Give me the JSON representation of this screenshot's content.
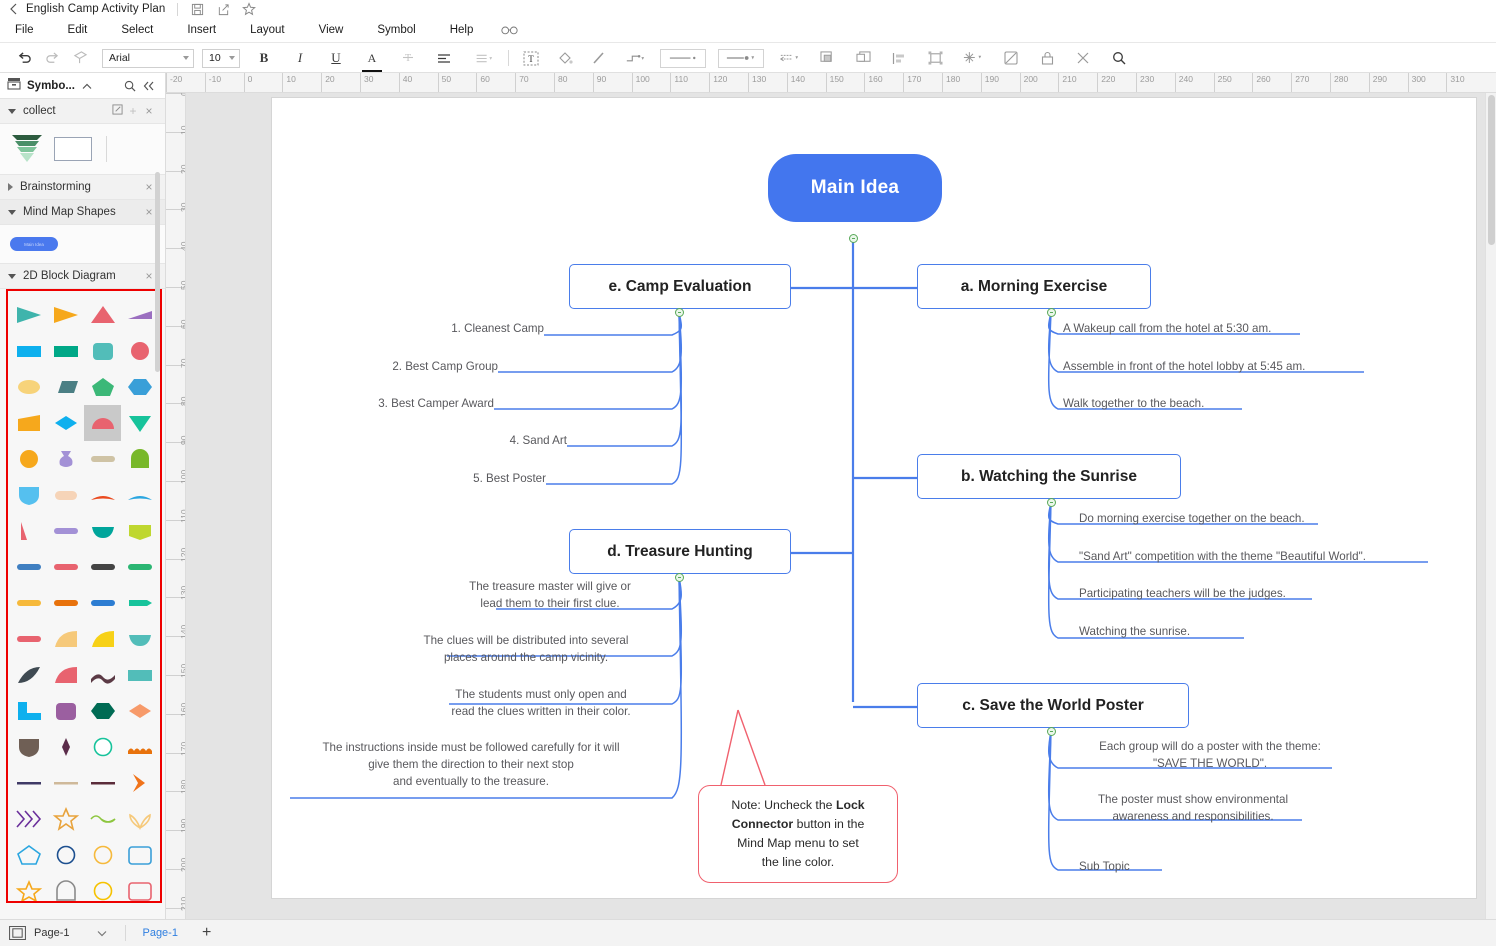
{
  "titlebar": {
    "back_icon": "chevron-left-icon",
    "document_title": "English Camp Activity Plan",
    "icons": [
      "save-icon",
      "share-icon",
      "star-icon"
    ]
  },
  "menubar": {
    "items": [
      "File",
      "Edit",
      "Select",
      "Insert",
      "Layout",
      "View",
      "Symbol",
      "Help"
    ],
    "trailing_icon": "glasses-icon"
  },
  "toolbar": {
    "font_family": "Arial",
    "font_size": "10",
    "groups": [
      {
        "name": "history",
        "icons": [
          "undo-icon",
          "redo-icon",
          "format-painter-icon"
        ]
      },
      {
        "name": "text-format",
        "icons": [
          "bold-icon",
          "italic-icon",
          "underline-icon",
          "font-color-icon",
          "strikethrough-icon",
          "align-icon",
          "line-spacing-icon"
        ]
      },
      {
        "name": "shape-tools",
        "icons": [
          "text-box-icon",
          "fill-color-icon",
          "line-color-icon",
          "connector-icon"
        ]
      },
      {
        "name": "line-style",
        "icons": [
          "line-weight-dropdown",
          "arrow-style-dropdown",
          "arrow-direction-icon"
        ]
      },
      {
        "name": "arrange",
        "icons": [
          "bring-forward-icon",
          "send-backward-icon",
          "align-left-icon",
          "group-icon",
          "effects-icon",
          "no-fill-icon",
          "lock-icon",
          "tools-icon",
          "search-icon"
        ]
      }
    ]
  },
  "sidebar": {
    "header_title": "Symbo...",
    "header_icons": [
      "library-icon",
      "collapse-chevron-icon",
      "search-icon",
      "double-chevron-left-icon"
    ],
    "sections": [
      {
        "label": "collect",
        "expanded": true,
        "icons": [
          "edit-icon",
          "plus-icon",
          "close-icon"
        ]
      },
      {
        "label": "Brainstorming",
        "expanded": false,
        "icons": [
          "close-icon"
        ]
      },
      {
        "label": "Mind Map Shapes",
        "expanded": true,
        "icons": [
          "close-icon"
        ]
      },
      {
        "label": "2D Block Diagram",
        "expanded": true,
        "icons": [
          "close-icon"
        ]
      }
    ],
    "mind_map_shape_label": "Main Idea",
    "shape_palette": {
      "selected_index": 14,
      "colors": [
        "#3fb4ac",
        "#f6a81c",
        "#e8636f",
        "#9b6fc0",
        "#0eb0ee",
        "#00a887",
        "#52bdb9",
        "#e8636f",
        "#f7d37a",
        "#4b7f84",
        "#3cb878",
        "#3a9fd8",
        "#f6a81c",
        "#0eb0ee",
        "#e8636f",
        "#17c39b",
        "#f6a81c",
        "#a391d6",
        "#cfc3a5",
        "#78b82a",
        "#55c0ef",
        "#f6d4b8",
        "#ea4a1f",
        "#2ba6e0",
        "#e8636f",
        "#a391d6",
        "#00a59b",
        "#bfd730",
        "#3f7fc1",
        "#e8636f",
        "#444444",
        "#2bb673",
        "#f6b93b",
        "#e8720c",
        "#2d7dd2",
        "#17c39b",
        "#e8636f",
        "#f6c97a",
        "#f7d117",
        "#52bdb9",
        "#3f4a52",
        "#e8636f",
        "#5b3a45",
        "#52bdb9",
        "#0eb0ee",
        "#9b5fa0",
        "#006b54",
        "#f79a6a",
        "#6f5f55",
        "#5b2c4a",
        "#17c39b",
        "#e8720c",
        "#3f3a66",
        "#cfb99a",
        "#5b2c3a",
        "#f0731a",
        "#6a2f9b",
        "#e8a33c",
        "#8dc63f",
        "#f6c97a",
        "#2ba6e0",
        "#1c4f8f",
        "#f6b93b",
        "#3a9fd8",
        "#f6a81c",
        "#8a8a8a",
        "#f6c200",
        "#e8636f"
      ]
    }
  },
  "ruler": {
    "horizontal_ticks": [
      "-20",
      "-10",
      "0",
      "10",
      "20",
      "30",
      "40",
      "50",
      "60",
      "70",
      "80",
      "90",
      "100",
      "110",
      "120",
      "130",
      "140",
      "150",
      "160",
      "170",
      "180",
      "190",
      "200",
      "210",
      "220",
      "230",
      "240",
      "250",
      "260",
      "270",
      "280",
      "290",
      "300",
      "310"
    ],
    "vertical_ticks": [
      "0",
      "10",
      "20",
      "30",
      "40",
      "50",
      "60",
      "70",
      "80",
      "90",
      "100",
      "110",
      "120",
      "130",
      "140",
      "150",
      "160",
      "170",
      "180",
      "190",
      "200",
      "210"
    ]
  },
  "mindmap": {
    "root": {
      "label": "Main Idea"
    },
    "branches": [
      {
        "id": "a",
        "label": "a. Morning Exercise",
        "side": "right",
        "children": [
          "A Wakeup call from the hotel at 5:30 am.",
          "Assemble in front of the hotel lobby at 5:45 am.",
          "Walk together to the beach."
        ]
      },
      {
        "id": "b",
        "label": "b. Watching the Sunrise",
        "side": "right",
        "children": [
          "Do morning exercise together on the beach.",
          "\"Sand Art\" competition with the theme \"Beautiful World\".",
          "Participating teachers will be the judges.",
          "Watching the sunrise."
        ]
      },
      {
        "id": "c",
        "label": "c. Save the World Poster",
        "side": "right",
        "children": [
          "Each group will do a poster with the theme:\n\"SAVE THE WORLD\".",
          "The poster must show environmental\nawareness and responsibilities.",
          "Sub Topic"
        ]
      },
      {
        "id": "d",
        "label": "d. Treasure Hunting",
        "side": "left",
        "children": [
          "The treasure master will give or\nlead them to their first clue.",
          "The clues will be distributed into several\nplaces around the camp vicinity.",
          "The students must only open and\nread the clues written in their color.",
          "The instructions inside must be followed carefully for it will\ngive them the direction to their next stop\nand eventually to the treasure."
        ]
      },
      {
        "id": "e",
        "label": "e. Camp Evaluation",
        "side": "left",
        "children": [
          "1. Cleanest Camp",
          "2. Best Camp Group",
          "3. Best Camper Award",
          "4. Sand Art",
          "5. Best Poster"
        ]
      }
    ],
    "callout": {
      "text_parts": [
        "Note: Uncheck the ",
        "Lock",
        "Connector",
        " button in the",
        "Mind Map menu to set",
        "the line color."
      ],
      "full_text": "Note: Uncheck the Lock Connector button in the Mind Map menu to set the line color.",
      "border_color": "#f0616e"
    },
    "colors": {
      "root_fill": "#4376ee",
      "node_border": "#4a7dea",
      "connector": "#4a7dea",
      "leaf_text": "#58585c",
      "handle": "#5aa95a"
    }
  },
  "statusbar": {
    "page_selector_icon": "page-layout-icon",
    "page_selector_label": "Page-1",
    "tab_label": "Page-1",
    "add_page_icon": "plus-icon"
  }
}
